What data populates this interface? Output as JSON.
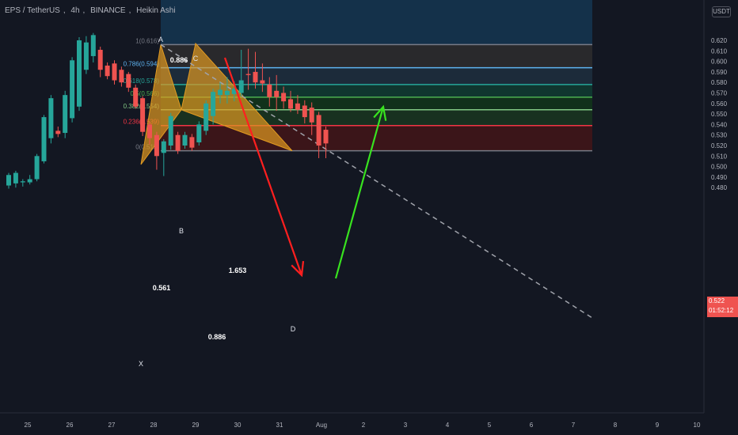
{
  "header": {
    "symbol": "EPS / TetherUS",
    "interval": "4h",
    "exchange": "BINANCE",
    "chart_style": "Heikin Ashi"
  },
  "currency_badge": "USDT",
  "last_price": {
    "value": "0.522",
    "countdown": "01:52:12"
  },
  "colors": {
    "background": "#131722",
    "up": "#26a69a",
    "down": "#ef5350",
    "pattern_fill": "#e19a21",
    "arrow_down": "#ff1f1f",
    "arrow_up": "#38e31f"
  },
  "chart_data": {
    "type": "candlestick",
    "y_axis": {
      "range": [
        0.478,
        0.627
      ],
      "ticks": [
        "0.620",
        "0.610",
        "0.600",
        "0.590",
        "0.580",
        "0.570",
        "0.560",
        "0.550",
        "0.540",
        "0.530",
        "0.520",
        "0.510",
        "0.500",
        "0.490",
        "0.480"
      ]
    },
    "x_axis": {
      "ticks": [
        "25",
        "26",
        "27",
        "28",
        "29",
        "30",
        "31",
        "Aug",
        "2",
        "3",
        "4",
        "5",
        "6",
        "7",
        "8",
        "9",
        "10"
      ]
    },
    "candles": [
      {
        "o": 0.482,
        "c": 0.492,
        "h": 0.494,
        "l": 0.479
      },
      {
        "o": 0.484,
        "c": 0.494,
        "h": 0.496,
        "l": 0.48
      },
      {
        "o": 0.485,
        "c": 0.486,
        "h": 0.488,
        "l": 0.481
      },
      {
        "o": 0.485,
        "c": 0.488,
        "h": 0.492,
        "l": 0.483
      },
      {
        "o": 0.488,
        "c": 0.51,
        "h": 0.512,
        "l": 0.486
      },
      {
        "o": 0.505,
        "c": 0.547,
        "h": 0.549,
        "l": 0.503
      },
      {
        "o": 0.527,
        "c": 0.565,
        "h": 0.568,
        "l": 0.522
      },
      {
        "o": 0.534,
        "c": 0.531,
        "h": 0.538,
        "l": 0.528
      },
      {
        "o": 0.532,
        "c": 0.568,
        "h": 0.572,
        "l": 0.527
      },
      {
        "o": 0.546,
        "c": 0.601,
        "h": 0.604,
        "l": 0.542
      },
      {
        "o": 0.557,
        "c": 0.62,
        "h": 0.623,
        "l": 0.553
      },
      {
        "o": 0.592,
        "c": 0.618,
        "h": 0.624,
        "l": 0.588
      },
      {
        "o": 0.605,
        "c": 0.625,
        "h": 0.627,
        "l": 0.599
      },
      {
        "o": 0.611,
        "c": 0.592,
        "h": 0.614,
        "l": 0.585
      },
      {
        "o": 0.596,
        "c": 0.586,
        "h": 0.599,
        "l": 0.583
      },
      {
        "o": 0.598,
        "c": 0.582,
        "h": 0.601,
        "l": 0.578
      },
      {
        "o": 0.592,
        "c": 0.58,
        "h": 0.595,
        "l": 0.576
      },
      {
        "o": 0.588,
        "c": 0.575,
        "h": 0.59,
        "l": 0.571
      },
      {
        "o": 0.575,
        "c": 0.557,
        "h": 0.578,
        "l": 0.555
      },
      {
        "o": 0.565,
        "c": 0.533,
        "h": 0.567,
        "l": 0.529
      },
      {
        "o": 0.54,
        "c": 0.527,
        "h": 0.543,
        "l": 0.521
      },
      {
        "o": 0.53,
        "c": 0.51,
        "h": 0.533,
        "l": 0.497
      },
      {
        "o": 0.513,
        "c": 0.524,
        "h": 0.526,
        "l": 0.491
      },
      {
        "o": 0.52,
        "c": 0.548,
        "h": 0.551,
        "l": 0.516
      },
      {
        "o": 0.53,
        "c": 0.515,
        "h": 0.533,
        "l": 0.512
      },
      {
        "o": 0.52,
        "c": 0.53,
        "h": 0.533,
        "l": 0.517
      },
      {
        "o": 0.528,
        "c": 0.518,
        "h": 0.531,
        "l": 0.515
      },
      {
        "o": 0.523,
        "c": 0.54,
        "h": 0.543,
        "l": 0.52
      },
      {
        "o": 0.534,
        "c": 0.56,
        "h": 0.563,
        "l": 0.53
      },
      {
        "o": 0.548,
        "c": 0.571,
        "h": 0.574,
        "l": 0.54
      },
      {
        "o": 0.568,
        "c": 0.573,
        "h": 0.58,
        "l": 0.56
      },
      {
        "o": 0.568,
        "c": 0.572,
        "h": 0.585,
        "l": 0.56
      },
      {
        "o": 0.569,
        "c": 0.574,
        "h": 0.581,
        "l": 0.562
      },
      {
        "o": 0.57,
        "c": 0.582,
        "h": 0.611,
        "l": 0.567
      },
      {
        "o": 0.588,
        "c": 0.587,
        "h": 0.612,
        "l": 0.573
      },
      {
        "o": 0.59,
        "c": 0.58,
        "h": 0.609,
        "l": 0.574
      },
      {
        "o": 0.582,
        "c": 0.579,
        "h": 0.598,
        "l": 0.571
      },
      {
        "o": 0.578,
        "c": 0.566,
        "h": 0.585,
        "l": 0.557
      },
      {
        "o": 0.572,
        "c": 0.566,
        "h": 0.587,
        "l": 0.553
      },
      {
        "o": 0.57,
        "c": 0.562,
        "h": 0.576,
        "l": 0.555
      },
      {
        "o": 0.564,
        "c": 0.555,
        "h": 0.572,
        "l": 0.552
      },
      {
        "o": 0.56,
        "c": 0.554,
        "h": 0.568,
        "l": 0.55
      },
      {
        "o": 0.558,
        "c": 0.547,
        "h": 0.563,
        "l": 0.541
      },
      {
        "o": 0.556,
        "c": 0.542,
        "h": 0.561,
        "l": 0.53
      },
      {
        "o": 0.549,
        "c": 0.52,
        "h": 0.552,
        "l": 0.508
      },
      {
        "o": 0.535,
        "c": 0.522,
        "h": 0.538,
        "l": 0.508
      }
    ],
    "fib_levels": [
      {
        "label": "1(0.616)",
        "price": 0.616,
        "line": "#787b86",
        "fill": "#2a2a2d"
      },
      {
        "label": "0.786(0.594)",
        "price": 0.594,
        "line": "#5eb3f0",
        "fill": "#1c2c3c"
      },
      {
        "label": "0.618(0.578)",
        "price": 0.578,
        "line": "#26a69a",
        "fill": "#103830"
      },
      {
        "label": "0.5(0.566)",
        "price": 0.566,
        "line": "#4caf50",
        "fill": "#11331b"
      },
      {
        "label": "0.382(0.554)",
        "price": 0.554,
        "line": "#81c784",
        "fill": "#183321"
      },
      {
        "label": "0.236(0.539)",
        "price": 0.539,
        "line": "#f23645",
        "fill": "#3d1519"
      },
      {
        "label": "0(0.515)",
        "price": 0.515,
        "line": "#787b86",
        "fill": null
      }
    ],
    "harmonic_points": [
      {
        "name": "X",
        "price": 0.502
      },
      {
        "name": "A",
        "price": 0.616
      },
      {
        "name": "B",
        "price": 0.554
      },
      {
        "name": "C",
        "price": 0.617
      },
      {
        "name": "D",
        "price": 0.515
      }
    ],
    "pattern_ratios": [
      "0.886",
      "0.561",
      "1.653",
      "0.886"
    ]
  }
}
